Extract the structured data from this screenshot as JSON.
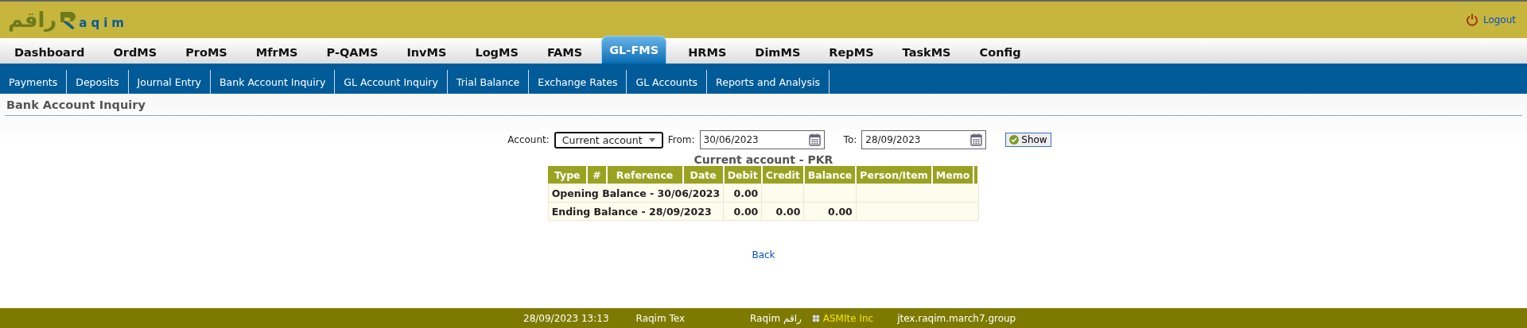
{
  "header": {
    "logo_arabic": "راقم",
    "logo_latin": "aqim",
    "logout": "Logout"
  },
  "main_menu": [
    {
      "label": "Dashboard",
      "selected": false
    },
    {
      "label": "OrdMS",
      "selected": false
    },
    {
      "label": "ProMS",
      "selected": false
    },
    {
      "label": "MfrMS",
      "selected": false
    },
    {
      "label": "P-QAMS",
      "selected": false
    },
    {
      "label": "InvMS",
      "selected": false
    },
    {
      "label": "LogMS",
      "selected": false
    },
    {
      "label": "FAMS",
      "selected": false
    },
    {
      "label": "GL-FMS",
      "selected": true
    },
    {
      "label": "HRMS",
      "selected": false
    },
    {
      "label": "DimMS",
      "selected": false
    },
    {
      "label": "RepMS",
      "selected": false
    },
    {
      "label": "TaskMS",
      "selected": false
    },
    {
      "label": "Config",
      "selected": false
    }
  ],
  "sub_menu": [
    "Payments",
    "Deposits",
    "Journal Entry",
    "Bank Account Inquiry",
    "GL Account Inquiry",
    "Trial Balance",
    "Exchange Rates",
    "GL Accounts",
    "Reports and Analysis"
  ],
  "page_title": "Bank Account Inquiry",
  "filters": {
    "account_label": "Account:",
    "account": "Current account",
    "from_label": "From:",
    "from": "30/06/2023",
    "to_label": "To:",
    "to": "28/09/2023",
    "show": "Show"
  },
  "table": {
    "title": "Current account - PKR",
    "columns": [
      "Type",
      "#",
      "Reference",
      "Date",
      "Debit",
      "Credit",
      "Balance",
      "Person/Item",
      "Memo"
    ],
    "rows": [
      {
        "label": "Opening Balance - 30/06/2023",
        "debit": "0.00"
      },
      {
        "label": "Ending Balance - 28/09/2023",
        "debit": "0.00",
        "credit": "0.00",
        "balance": "0.00"
      }
    ]
  },
  "back": "Back",
  "footer": {
    "datetime": "28/09/2023 13:13",
    "company": "Raqim Tex",
    "brand": "Raqim راقم",
    "vendor": "ASMIte Inc",
    "host": "jtex.raqim.march7.group"
  }
}
